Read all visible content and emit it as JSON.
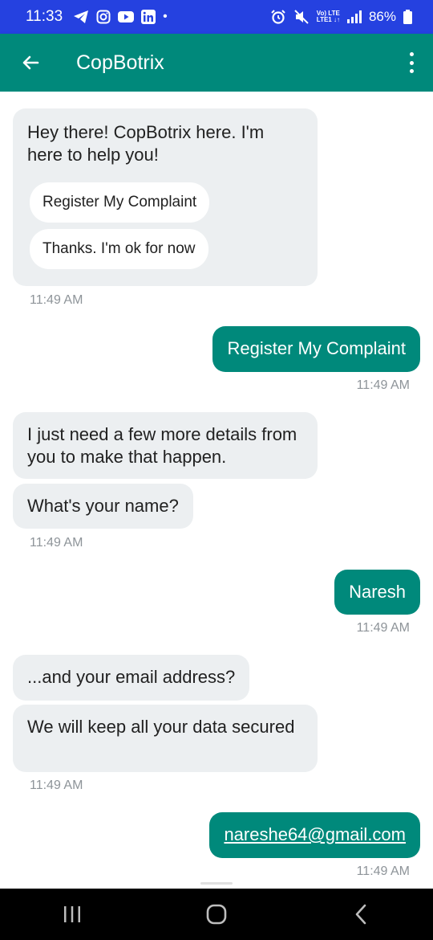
{
  "status_bar": {
    "time": "11:33",
    "dot": "•",
    "battery": "86%",
    "network_top": "Vo) LTE",
    "network_bottom": "LTE1 ↓↑",
    "icons": [
      "telegram-icon",
      "instagram-icon",
      "youtube-icon",
      "linkedin-icon",
      "alarm-icon",
      "mute-icon",
      "signal-icon",
      "battery-icon"
    ]
  },
  "app_bar": {
    "title": "CopBotrix",
    "color": "#00897b"
  },
  "messages": {
    "m1": {
      "text": "Hey there! CopBotrix here. I'm here to help you!",
      "time": "11:49 AM"
    },
    "quick_replies": [
      "Register My Complaint",
      "Thanks. I'm ok for now"
    ],
    "m2": {
      "text": "Register My Complaint",
      "time": "11:49 AM"
    },
    "m3": {
      "text": "I just need a few more details from you to make that happen."
    },
    "m4": {
      "text": "What's your name?",
      "time": "11:49 AM"
    },
    "m5": {
      "text": "Naresh",
      "time": "11:49 AM"
    },
    "m6": {
      "text": "...and your email address?"
    },
    "m7": {
      "text": "We will keep all your data secured",
      "time": "11:49 AM"
    },
    "m8": {
      "text": "nareshe64@gmail.com",
      "time": "11:49 AM"
    }
  },
  "nav_bar": {
    "icons": [
      "recents-icon",
      "home-icon",
      "back-icon"
    ]
  }
}
